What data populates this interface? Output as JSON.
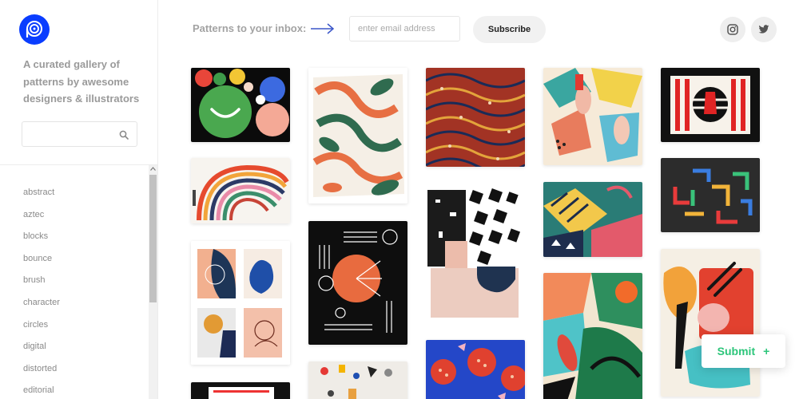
{
  "brand": {
    "logo": "p-spiral-logo",
    "accent": "#0a3dff"
  },
  "sidebar": {
    "tagline": "A curated gallery of patterns by awesome designers & illustrators",
    "search": {
      "placeholder": "",
      "value": ""
    },
    "tags": [
      "abstract",
      "aztec",
      "blocks",
      "bounce",
      "brush",
      "character",
      "circles",
      "digital",
      "distorted",
      "editorial"
    ]
  },
  "header": {
    "newsletter_label": "Patterns to your inbox:",
    "email_placeholder": "enter email address",
    "subscribe_label": "Subscribe",
    "social": [
      "instagram-icon",
      "twitter-icon"
    ]
  },
  "gallery": {
    "columns": 5,
    "items_visible": 18
  },
  "submit": {
    "label": "Submit",
    "icon": "+",
    "color": "#2cc57a"
  }
}
